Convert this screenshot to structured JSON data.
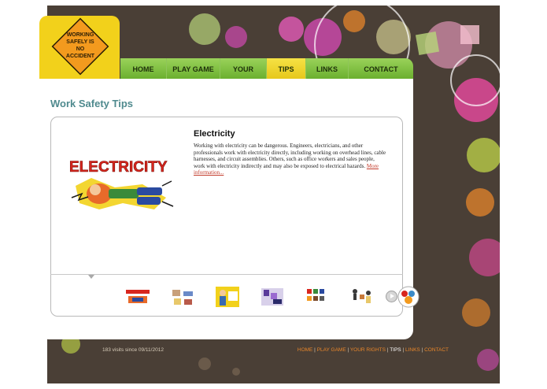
{
  "sign": {
    "line1": "WORKING",
    "line2": "SAFELY IS",
    "line3": "NO",
    "line4": "ACCIDENT"
  },
  "nav": [
    "HOME",
    "PLAY GAME",
    "YOUR RIGHTS",
    "TIPS",
    "LINKS",
    "CONTACT"
  ],
  "nav_active": "TIPS",
  "page_title": "Work Safety Tips",
  "tip": {
    "heading": "Electricity",
    "body": "Working with electricity can be dangerous. Engineers, electricians, and other professionals work with electricity directly, including working on overhead lines, cable harnesses, and circuit assemblies. Others, such as office workers and sales people, work with electricity indirectly and may also be exposed to electrical hazards.",
    "more": "More information..."
  },
  "art_label": "ELECTRICITY",
  "thumbnails": [
    "electricity-thumb",
    "ladder-thumb",
    "worker-thumb",
    "chemicals-thumb",
    "tools-thumb",
    "lifting-thumb",
    "ppe-thumb"
  ],
  "footer": {
    "visits": "183 visits since 09/11/2012",
    "links": [
      "HOME",
      "PLAY GAME",
      "YOUR RIGHTS",
      "TIPS",
      "LINKS",
      "CONTACT"
    ]
  },
  "colors": {
    "nav_green": "#6bb02f",
    "active_yellow": "#e6c81b",
    "title_teal": "#4f8a8e",
    "link_red": "#c23a2a",
    "footer_orange": "#e8862a"
  }
}
